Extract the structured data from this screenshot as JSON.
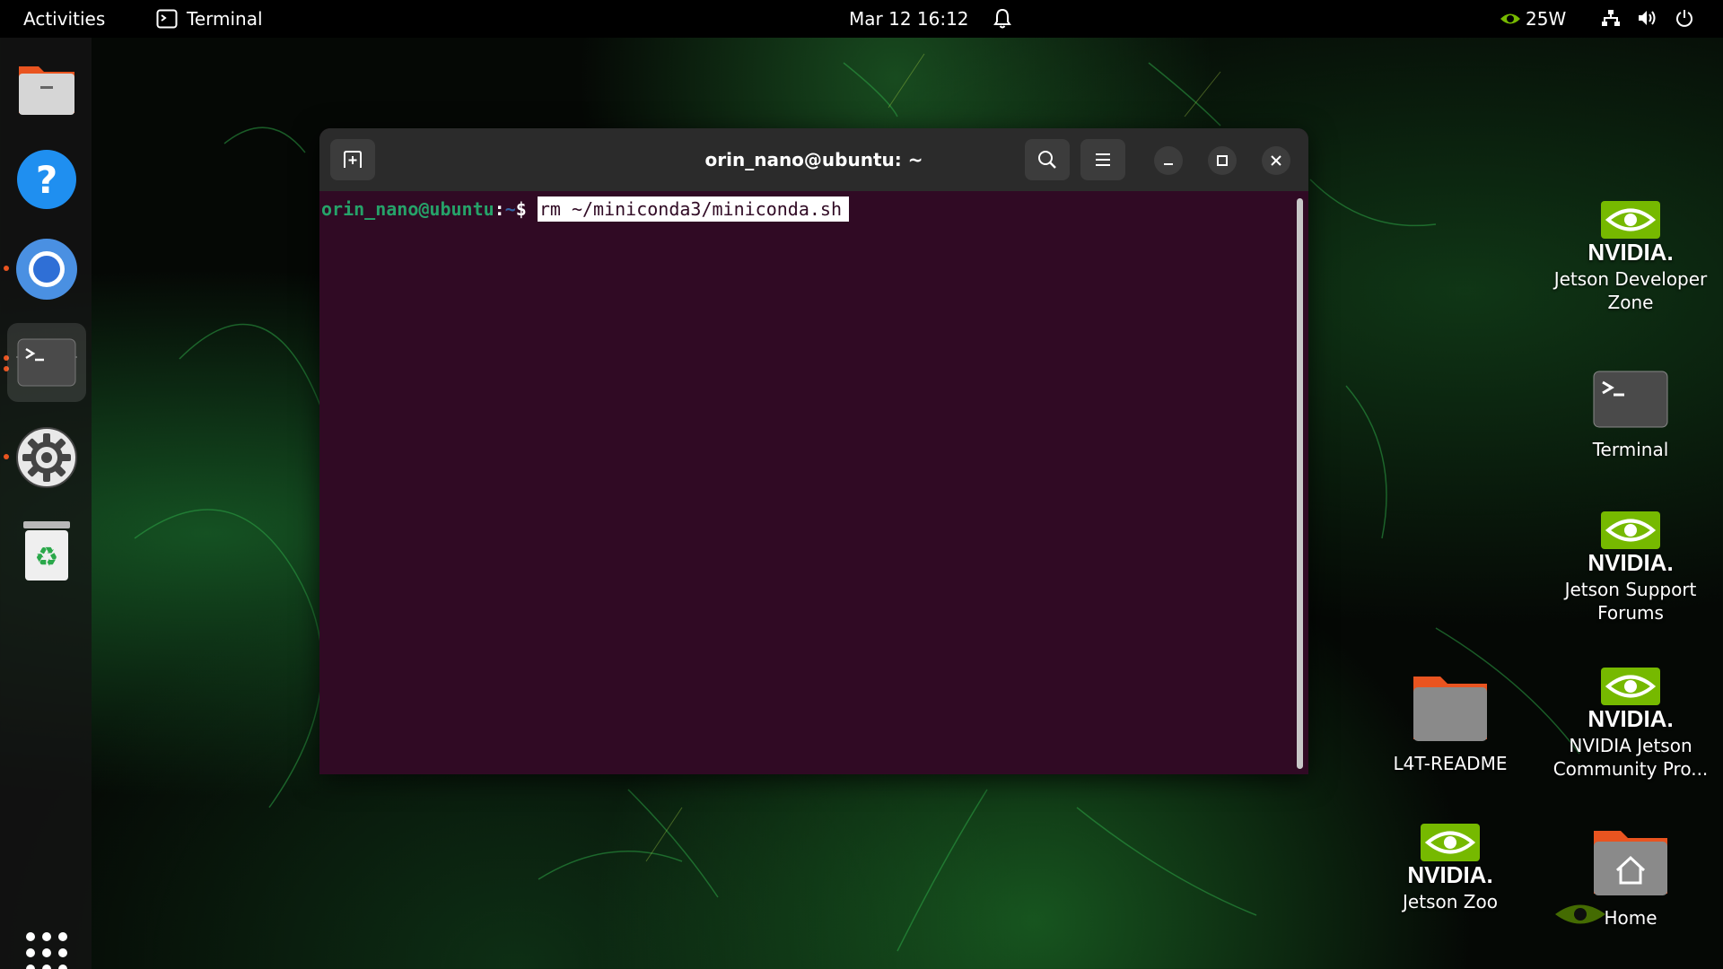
{
  "topbar": {
    "activities": "Activities",
    "app_name": "Terminal",
    "clock": "Mar 12  16:12",
    "power_mode": "25W"
  },
  "dock": {
    "items": [
      {
        "name": "Files"
      },
      {
        "name": "Help"
      },
      {
        "name": "Chromium"
      },
      {
        "name": "Terminal"
      },
      {
        "name": "Settings"
      },
      {
        "name": "Trash"
      }
    ]
  },
  "terminal": {
    "title": "orin_nano@ubuntu: ~",
    "prompt_user": "orin_nano@ubuntu",
    "prompt_colon": ":",
    "prompt_path": "~",
    "prompt_symbol": "$ ",
    "command": "rm ~/miniconda3/miniconda.sh"
  },
  "desktop": {
    "nvidia_word": "NVIDIA.",
    "icons": [
      {
        "label": "Jetson Developer Zone"
      },
      {
        "label": "Terminal"
      },
      {
        "label": "Jetson Support Forums"
      },
      {
        "label": "L4T-README"
      },
      {
        "label": "NVIDIA Jetson Community Pro..."
      },
      {
        "label": "Jetson Zoo"
      },
      {
        "label": "Home"
      }
    ]
  },
  "colors": {
    "terminal_bg": "#300a24",
    "prompt_green": "#26a269",
    "prompt_blue": "#3465a4",
    "ubuntu_orange": "#e95420",
    "nvidia_green": "#76b900"
  }
}
